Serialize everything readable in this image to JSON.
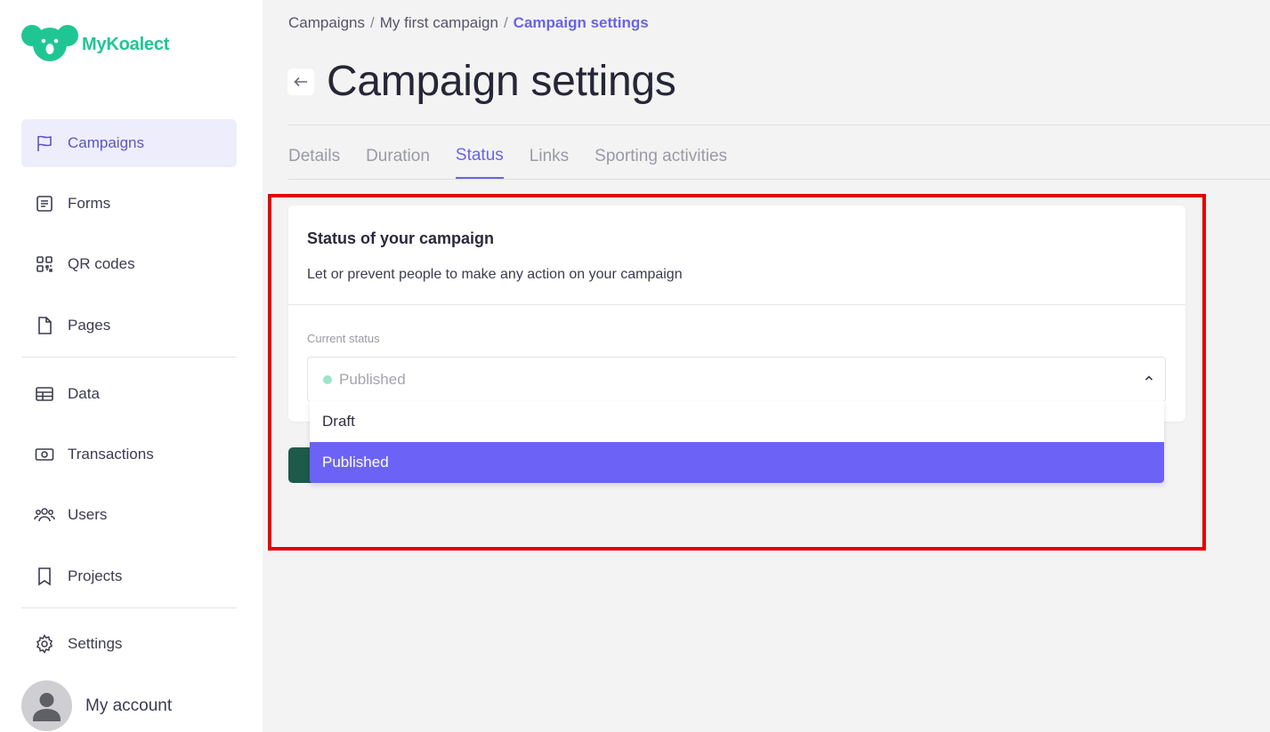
{
  "app": {
    "name": "MyKoalect",
    "brand_color": "#1fc694",
    "accent_color": "#6a63e6"
  },
  "sidebar": {
    "items": [
      {
        "label": "Campaigns",
        "icon": "flag-icon",
        "active": true
      },
      {
        "label": "Forms",
        "icon": "form-icon",
        "active": false
      },
      {
        "label": "QR codes",
        "icon": "qr-code-icon",
        "active": false
      },
      {
        "label": "Pages",
        "icon": "page-icon",
        "active": false
      },
      {
        "label": "Data",
        "icon": "table-icon",
        "active": false
      },
      {
        "label": "Transactions",
        "icon": "money-icon",
        "active": false
      },
      {
        "label": "Users",
        "icon": "users-icon",
        "active": false
      },
      {
        "label": "Projects",
        "icon": "bookmark-icon",
        "active": false
      },
      {
        "label": "Settings",
        "icon": "gear-icon",
        "active": false
      }
    ],
    "account_label": "My account"
  },
  "breadcrumb": {
    "items": [
      "Campaigns",
      "My first campaign",
      "Campaign settings"
    ],
    "separator": "/"
  },
  "page": {
    "title": "Campaign settings"
  },
  "tabs": [
    {
      "label": "Details",
      "active": false
    },
    {
      "label": "Duration",
      "active": false
    },
    {
      "label": "Status",
      "active": true
    },
    {
      "label": "Links",
      "active": false
    },
    {
      "label": "Sporting activities",
      "active": false
    }
  ],
  "status_card": {
    "title": "Status of your campaign",
    "description": "Let or prevent people to make any action on your campaign",
    "field_label": "Current status",
    "current_value": "Published",
    "status_color": "#9ce6c8",
    "options": [
      {
        "label": "Draft",
        "selected": false
      },
      {
        "label": "Published",
        "selected": true
      }
    ]
  }
}
